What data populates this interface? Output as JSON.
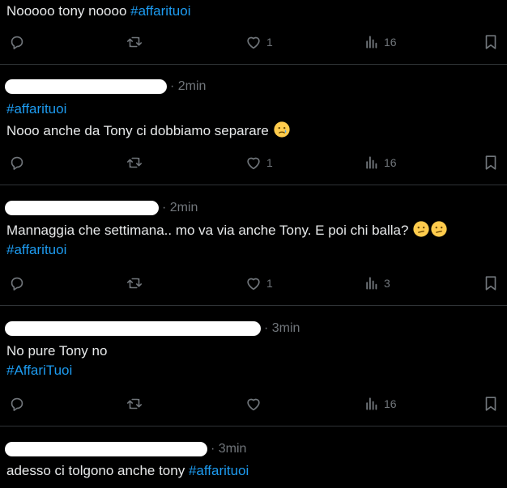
{
  "posts": [
    {
      "time": "",
      "lines": [
        {
          "text": "Nooooo tony noooo ",
          "hashtag": "#affarituoi"
        }
      ],
      "replies": "",
      "likes": "1",
      "views": "16"
    },
    {
      "time": "· 2min",
      "lines": [
        {
          "text": "",
          "hashtag": "#affarituoi"
        },
        {
          "text": "Nooo anche da Tony ci dobbiamo separare ",
          "hashtag": ""
        }
      ],
      "emoji": [
        "crying-face"
      ],
      "likes": "1",
      "views": "16"
    },
    {
      "time": "· 2min",
      "lines": [
        {
          "text": "Mannaggia che settimana.. mo va via anche Tony. E poi chi balla? ",
          "hashtag": ""
        },
        {
          "text": "",
          "hashtag": "#affarituoi"
        }
      ],
      "emoji": [
        "confused-face",
        "confused-face"
      ],
      "likes": "1",
      "views": "3"
    },
    {
      "time": "· 3min",
      "lines": [
        {
          "text": "No pure Tony no",
          "hashtag": ""
        },
        {
          "text": "",
          "hashtag": "#AffariTuoi"
        }
      ],
      "likes": "",
      "views": "16"
    },
    {
      "time": "· 3min",
      "lines": [
        {
          "text": "adesso ci tolgono anche tony ",
          "hashtag": "#affarituoi"
        }
      ]
    }
  ],
  "icons": {
    "reply": "reply-icon",
    "repost": "repost-icon",
    "like": "heart-icon",
    "views": "views-icon",
    "bookmark": "bookmark-icon"
  },
  "colors": {
    "background": "#000000",
    "text": "#e7e9ea",
    "hashtag": "#1d9bf0",
    "muted": "#71767b",
    "divider": "#2f3336"
  }
}
